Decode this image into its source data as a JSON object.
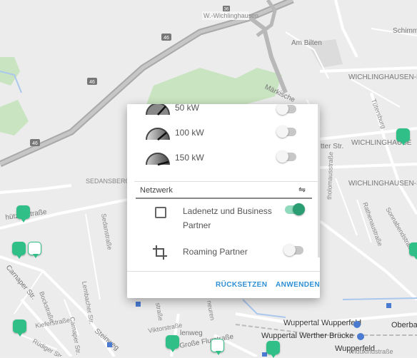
{
  "map": {
    "places": {
      "w_wichlinghausen": "W.-Wichlinghausen",
      "schimmel": "Schimme",
      "am_bilten": "Am Bilten",
      "wichlinghausen_nord": "WICHLINGHAUSEN-N",
      "tuetersburg": "Tütersburg",
      "wichlinghausen": "WICHLINGHAUSE",
      "muerkische": "Märkische",
      "tter_str": "tter Str.",
      "sedansberg": "SEDANSBERG",
      "wichlinghausen_sued": "WICHLINGHAUSEN-SÜD",
      "rathenaustrasse": "Rathenaustraße",
      "sonnabendstrasse": "Sonnabendstraße",
      "schuetzenstrasse": "hützenstraße",
      "carnaper_str": "Carnaper Str.",
      "bockstrasse": "Bockstraße",
      "kieferstrasse": "Kieferstraße",
      "ruediger_str": "Rüdiger Str.",
      "lembacher_str": "Lembacher Str.",
      "carnaper_str2": "Carnaper Str.",
      "steinweg": "Steinweg",
      "viktorstrasse": "Viktorstraße",
      "lenweg": "lenweg",
      "grosse_flurstrasse": "Große Flurstraße",
      "sedanstrasse": "Sedanstraße",
      "strasse": "straße",
      "neuren": "neuren",
      "wuppertal_wupperfeld": "Wuppertal Wupperfeld",
      "wuppertal_werther": "Wuppertal Werther Brücke",
      "wupperfeld": "Wupperfeld",
      "oberbarmen": "Oberban",
      "widukindstrasse": "Widukindstraße",
      "hofaue": "tholomausstraße",
      "highway_46": "46",
      "highway_46b": "46",
      "highway_46c": "46",
      "road_36": "36"
    }
  },
  "filter_panel": {
    "power_options": [
      {
        "label": "50 kW",
        "enabled": false
      },
      {
        "label": "100 kW",
        "enabled": false
      },
      {
        "label": "150 kW",
        "enabled": false
      }
    ],
    "network_section": {
      "title": "Netzwerk",
      "sort_icon": "⇋"
    },
    "network_options": [
      {
        "label_line1": "Ladenetz und Business",
        "label_line2": "Partner",
        "enabled": true,
        "icon": "checkbox-outline-icon"
      },
      {
        "label_line1": "Roaming Partner",
        "enabled": false,
        "icon": "crop-icon"
      }
    ],
    "buttons": {
      "reset": "RÜCKSETZEN",
      "apply": "ANWENDEN"
    }
  },
  "colors": {
    "accent_green": "#2fbf87",
    "toggle_on": "#2a9d73",
    "button_blue": "#2e8fd4"
  }
}
